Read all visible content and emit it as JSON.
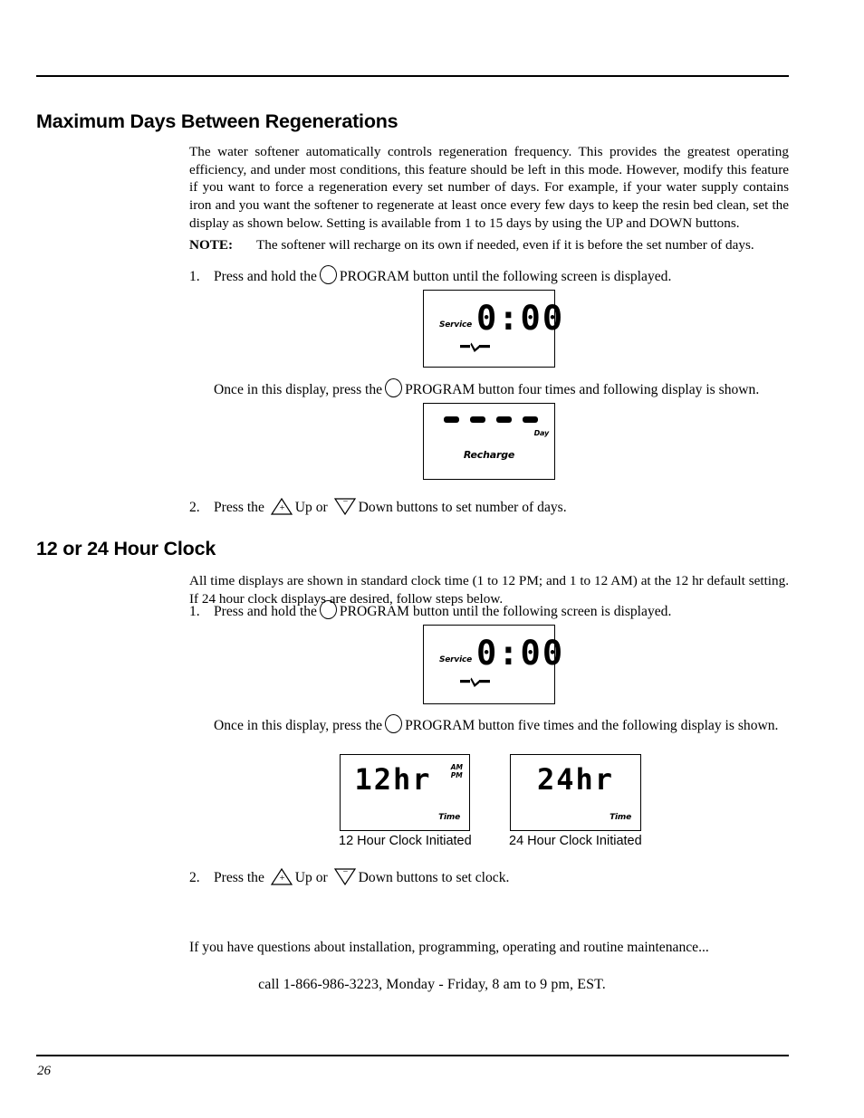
{
  "page": {
    "number": "26"
  },
  "sections": {
    "max_days": {
      "heading": "Maximum Days Between Regenerations",
      "intro": "The water softener automatically controls regeneration frequency. This provides the greatest operating efficiency, and under most conditions, this feature should be left in this mode.  However, modify this feature if you want to force a regeneration every set number of days. For example, if your water supply contains iron and you want the softener to regenerate at least once every few days to keep the resin bed clean, set the display as shown below. Setting is available from 1 to 15 days by using the UP and DOWN buttons.",
      "note_label": "NOTE:",
      "note_text": "The softener will recharge on its own if needed, even if it is before the set number of days.",
      "step1_num": "1.",
      "step1_before": "Press and hold the",
      "step1_after": "PROGRAM button until  the following screen is displayed.",
      "once_before": "Once in this display, press the",
      "once_after": "PROGRAM button four times and following display is shown.",
      "step2_num": "2.",
      "step2_before": "Press the",
      "step2_mid": "Up or",
      "step2_after": "Down buttons to set number of days."
    },
    "clock": {
      "heading": "12 or 24 Hour Clock",
      "intro": "All time displays are shown in standard clock time (1 to 12 PM; and 1 to 12 AM) at the 12 hr default setting. If 24 hour clock displays are desired, follow steps below.",
      "step1_num": "1.",
      "step1_before": "Press and hold the",
      "step1_after": "PROGRAM button until  the following screen is displayed.",
      "once_before": "Once in this display, press the",
      "once_after": "PROGRAM button five times and the following display is shown.",
      "step2_num": "2.",
      "step2_before": "Press the",
      "step2_mid": "Up or",
      "step2_after": "Down buttons to set clock."
    }
  },
  "lcd_displays": {
    "service_1": {
      "status_label": "Service",
      "digits": "0:00",
      "flow_icon": "faucet-flow-icon"
    },
    "recharge": {
      "dashes": "- - - -",
      "unit_label": "Day",
      "status_label": "Recharge"
    },
    "service_2": {
      "status_label": "Service",
      "digits": "0:00",
      "flow_icon": "faucet-flow-icon"
    },
    "twelve_hour": {
      "digits": "12hr",
      "am_label": "AM",
      "pm_label": "PM",
      "mode_label": "Time",
      "caption": "12 Hour Clock Initiated"
    },
    "twentyfour_hour": {
      "digits": "24hr",
      "mode_label": "Time",
      "caption": "24 Hour Clock Initiated"
    }
  },
  "buttons": {
    "program_icon": "program-circle-icon",
    "up_icon": "up-triangle-plus-icon",
    "up_sign": "+",
    "down_icon": "down-triangle-minus-icon",
    "down_sign": "−"
  },
  "footer": {
    "questions_line": "If you have questions about installation, programming, operating and routine maintenance...",
    "call_line": "call 1-866-986-3223, Monday - Friday, 8 am to 9 pm, EST."
  },
  "colors": {
    "ink": "#000000",
    "paper": "#ffffff"
  }
}
